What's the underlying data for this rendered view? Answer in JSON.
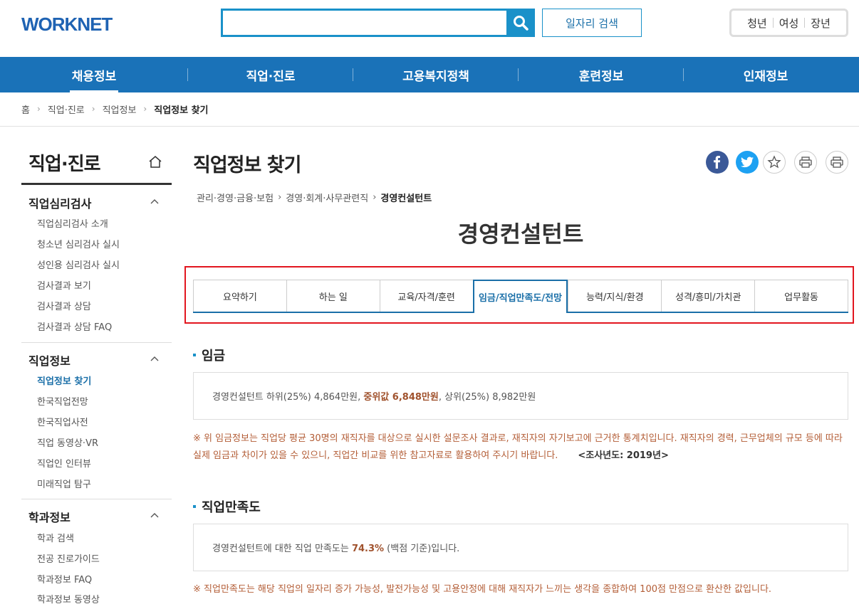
{
  "header": {
    "logo": "WORKNET",
    "search_placeholder": "",
    "search_icon": "search-icon",
    "job_search_label": "일자리 검색",
    "targets": [
      "청년",
      "여성",
      "장년"
    ]
  },
  "gnb": [
    "채용정보",
    "직업·진로",
    "고용복지정책",
    "훈련정보",
    "인재정보"
  ],
  "gnb_active": "채용정보",
  "breadcrumb": [
    "홈",
    "직업·진로",
    "직업정보",
    "직업정보 찾기"
  ],
  "sidebar": {
    "title": "직업·진로",
    "groups": [
      {
        "title": "직업심리검사",
        "items": [
          "직업심리검사 소개",
          "청소년 심리검사 실시",
          "성인용 심리검사 실시",
          "검사결과 보기",
          "검사결과 상담",
          "검사결과 상담 FAQ"
        ]
      },
      {
        "title": "직업정보",
        "items": [
          "직업정보 찾기",
          "한국직업전망",
          "한국직업사전",
          "직업 동영상·VR",
          "직업인 인터뷰",
          "미래직업 탐구"
        ]
      },
      {
        "title": "학과정보",
        "items": [
          "학과 검색",
          "전공 진로가이드",
          "학과정보 FAQ",
          "학과정보 동영상"
        ]
      }
    ],
    "active_item": "직업정보 찾기"
  },
  "main": {
    "page_title": "직업정보 찾기",
    "share_icons": [
      "facebook-icon",
      "twitter-icon",
      "star-icon",
      "print-preview-icon",
      "print-icon"
    ],
    "job_path": [
      "관리·경영·금융·보험",
      "경영·회계·사무관련직",
      "경영컨설턴트"
    ],
    "job_title": "경영컨설턴트",
    "tabs": [
      "요약하기",
      "하는 일",
      "교육/자격/훈련",
      "임금/직업만족도/전망",
      "능력/지식/환경",
      "성격/흥미/가치관",
      "업무활동"
    ],
    "active_tab": "임금/직업만족도/전망",
    "wage": {
      "title": "임금",
      "text_before": "경영컨설턴트 하위(25%) 4,864만원, ",
      "median": "중위값 6,848만원",
      "text_after": ", 상위(25%) 8,982만원",
      "note": "※ 위 임금정보는 직업당 평균 30명의 재직자를 대상으로 실시한 설문조사 결과로, 재직자의 자기보고에 근거한 통계치입니다. 재직자의 경력, 근무업체의 규모 등에 따라 실제 임금과 차이가 있을 수 있으니, 직업간 비교를 위한 참고자료로 활용하여 주시기 바랍니다.",
      "survey_year": "<조사년도: 2019년>"
    },
    "satisfaction": {
      "title": "직업만족도",
      "text_before": "경영컨설턴트에 대한 직업 만족도는 ",
      "value": "74.3%",
      "text_after": " (백점 기준)입니다.",
      "note": "※ 직업만족도는 해당 직업의 일자리 증가 가능성, 발전가능성 및 고용안정에 대해 재직자가 느끼는 생각을 종합하여 100점 만점으로 환산한 값입니다."
    }
  },
  "colors": {
    "primary": "#1a72b8",
    "accent": "#1a91c9",
    "highlight_red": "#e2161f",
    "note": "#b35d36"
  }
}
